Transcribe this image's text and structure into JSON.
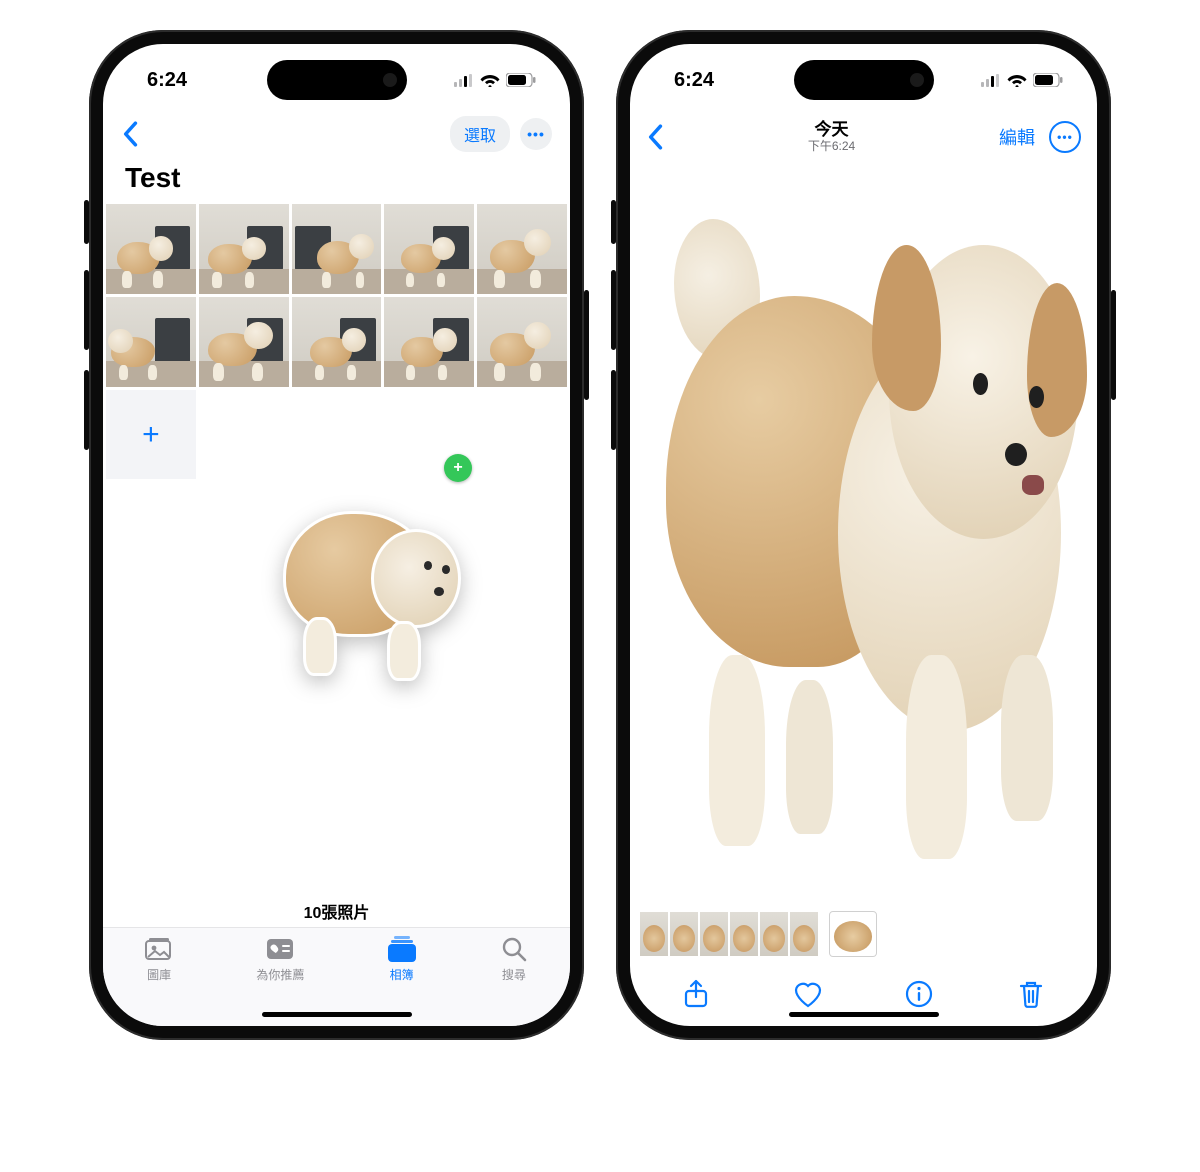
{
  "colors": {
    "accent": "#0a7aff",
    "badge": "#34c759"
  },
  "status": {
    "time": "6:24"
  },
  "left": {
    "nav": {
      "select_label": "選取"
    },
    "album_title": "Test",
    "grid": {
      "count": 10,
      "add_label": "+"
    },
    "drag_badge": "+",
    "count_text": "10張照片",
    "tabs": [
      {
        "key": "library",
        "label": "圖庫"
      },
      {
        "key": "foryou",
        "label": "為你推薦"
      },
      {
        "key": "albums",
        "label": "相簿",
        "active": true
      },
      {
        "key": "search",
        "label": "搜尋"
      }
    ]
  },
  "right": {
    "nav": {
      "title_top": "今天",
      "title_sub": "下午6:24",
      "edit_label": "編輯"
    },
    "filmstrip": {
      "count": 7,
      "selected_index": 6
    }
  }
}
